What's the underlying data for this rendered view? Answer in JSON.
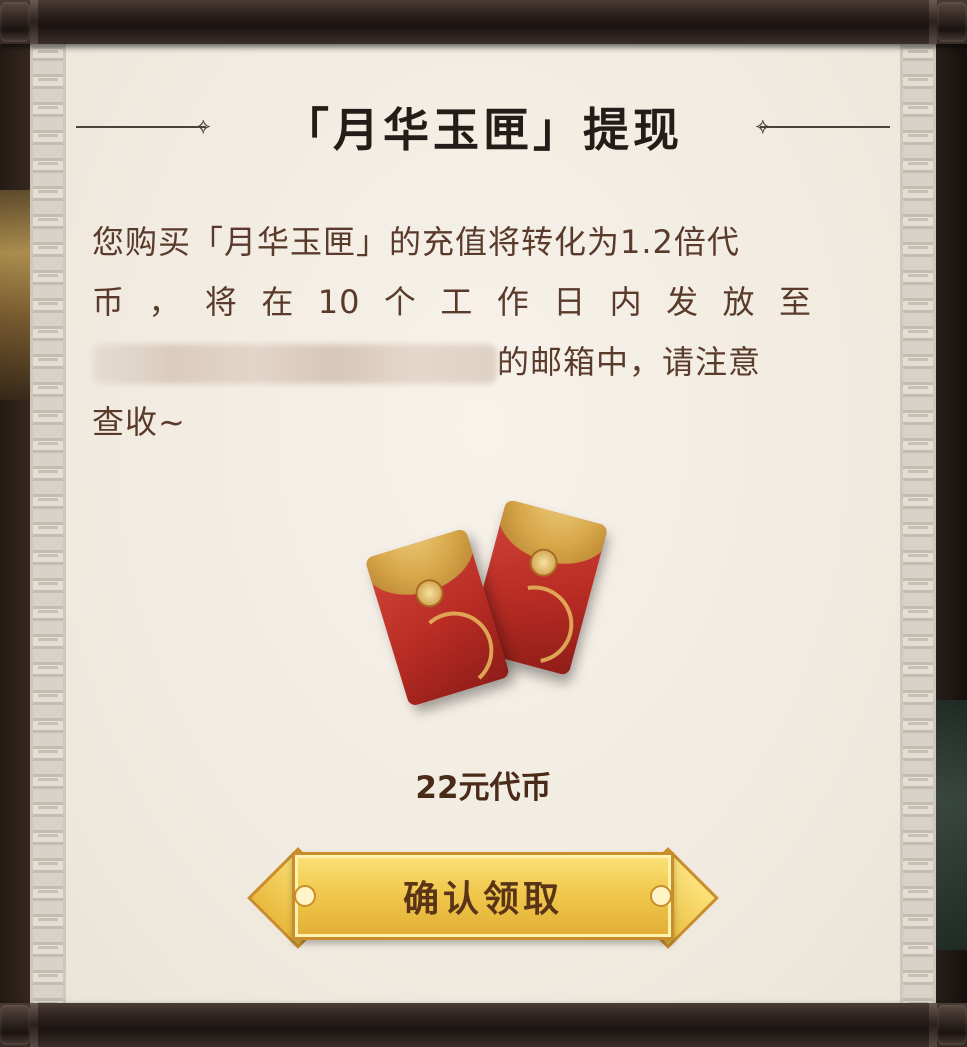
{
  "dialog": {
    "title": "「月华玉匣」提现",
    "message_line1": "您购买「月华玉匣」的充值将转化为1.2倍代",
    "message_line2_words": [
      "币",
      "，",
      "将",
      "在",
      "10",
      "个",
      "工",
      "作",
      "日",
      "内",
      "发",
      "放",
      "至"
    ],
    "message_line3_suffix": "的邮箱中，请注意",
    "message_line4": "查收~",
    "reward_label": "22元代币",
    "confirm_button_label": "确认领取"
  },
  "icons": {
    "title_ornament_left": "knot-ornament-icon",
    "title_ornament_right": "knot-ornament-icon",
    "reward_image": "red-envelopes-icon"
  },
  "colors": {
    "paper": "#f3ede3",
    "text": "#5a3a2a",
    "title": "#231d1a",
    "button_gold": "#f1c94d",
    "envelope_red": "#b82c24"
  }
}
